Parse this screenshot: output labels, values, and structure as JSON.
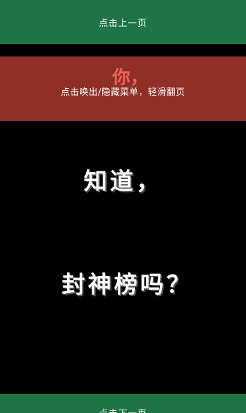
{
  "top_nav": {
    "prev_page_label": "点击上一页"
  },
  "menu_hint": "点击唤出/隐藏菜单，轻滑翻页",
  "peek_char": "你，",
  "content": {
    "line1": "知道，",
    "line2": "封神榜吗？"
  },
  "bottom_nav": {
    "next_page_label": "点击下一页"
  },
  "colors": {
    "nav_green": "#1f7446",
    "overlay_red": "#8f2f27",
    "background": "#000000"
  }
}
